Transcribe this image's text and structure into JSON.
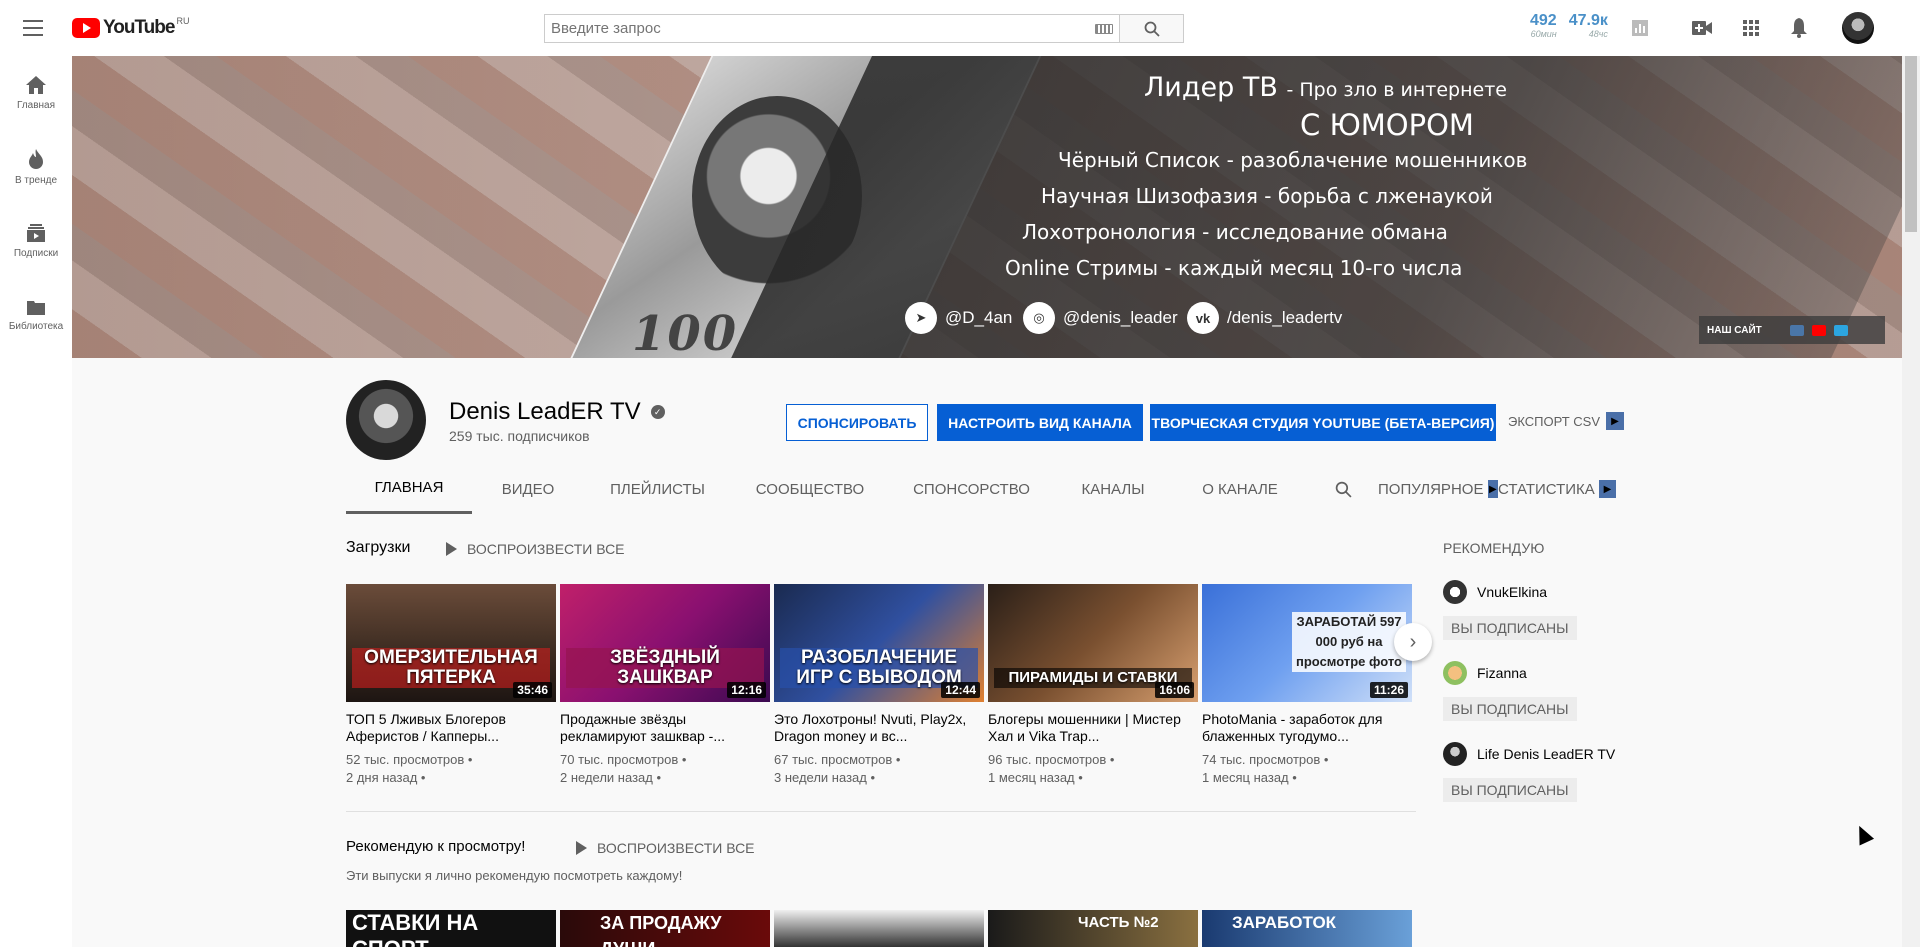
{
  "header": {
    "logo_text": "YouTube",
    "region": "RU",
    "search_placeholder": "Введите запрос",
    "stats": [
      {
        "value": "492",
        "label": "60мин"
      },
      {
        "value": "47.9к",
        "label": "48чс"
      }
    ]
  },
  "sidebar": {
    "items": [
      {
        "label": "Главная",
        "icon": "home-icon"
      },
      {
        "label": "В тренде",
        "icon": "flame-icon"
      },
      {
        "label": "Подписки",
        "icon": "subscriptions-icon"
      },
      {
        "label": "Библиотека",
        "icon": "library-icon"
      }
    ]
  },
  "banner": {
    "title": "Лидер ТВ",
    "title_suffix": "- Про зло в интернете",
    "humor": "С ЮМОРОМ",
    "lines": [
      "Чёрный Список - разоблачение мошенников",
      "Научная Шизофазия - борьба с лженаукой",
      "Лохотронология - исследование обмана",
      "Online Стримы - каждый месяц 10-го числа"
    ],
    "socials": [
      {
        "icon": "telegram-icon",
        "handle": "@D_4an"
      },
      {
        "icon": "instagram-icon",
        "handle": "@denis_leader"
      },
      {
        "icon": "vk-icon",
        "handle": "/denis_leadertv"
      }
    ],
    "bill_number": "100",
    "site_link": "НАШ САЙТ"
  },
  "channel": {
    "name": "Denis LeadER TV",
    "subscribers": "259 тыс. подписчиков",
    "sponsor_btn": "Спонсировать",
    "customize_btn": "Настроить вид канала",
    "studio_btn": "Творческая студия YouTube (бета-версия)",
    "export": "ЭКСПОРТ CSV",
    "tabs": [
      "Главная",
      "Видео",
      "Плейлисты",
      "Сообщество",
      "Спонсорство",
      "Каналы",
      "О канале",
      "Популярное",
      "Статистика"
    ]
  },
  "uploads": {
    "title": "Загрузки",
    "play_all": "Воспроизвести все",
    "videos": [
      {
        "thumb_text": "ОМЕРЗИТЕЛЬНАЯ ПЯТЕРКА",
        "duration": "35:46",
        "title": "ТОП 5 Лживых Блогеров Аферистов / Капперы...",
        "views": "52 тыс. просмотров •",
        "age": "2 дня назад •"
      },
      {
        "thumb_text": "ЗВЁЗДНЫЙ ЗАШКВАР",
        "duration": "12:16",
        "title": "Продажные звёзды рекламируют зашквар -...",
        "views": "70 тыс. просмотров •",
        "age": "2 недели назад •"
      },
      {
        "thumb_text": "РАЗОБЛАЧЕНИЕ ИГР С ВЫВОДОМ",
        "duration": "12:44",
        "title": "Это Лохотроны! Nvuti, Play2x, Dragon money и вс...",
        "views": "67 тыс. просмотров •",
        "age": "3 недели назад •"
      },
      {
        "thumb_text": "ПИРАМИДЫ И СТАВКИ",
        "duration": "16:06",
        "title": "Блогеры мошенники | Мистер Хал и Vika Trap...",
        "views": "96 тыс. просмотров •",
        "age": "1 месяц назад •"
      },
      {
        "thumb_text": "ЗАРАБОТАЙ 597 000 руб на просмотре фото",
        "duration": "11:26",
        "title": "PhotoMania - заработок для блаженных тугодумо...",
        "views": "74 тыс. просмотров •",
        "age": "1 месяц назад •"
      }
    ]
  },
  "recommended": {
    "title": "Рекомендую к просмотру!",
    "play_all": "Воспроизвести все",
    "desc": "Эти выпуски я лично рекомендую посмотреть каждому!",
    "thumbs": [
      "СТАВКИ НА СПОРТ",
      "ЗА ПРОДАЖУ ДУШИ",
      "",
      "ЧАСТЬ №2",
      "ЗАРАБОТОК"
    ]
  },
  "sidebar_right": {
    "title": "Рекомендую",
    "channels": [
      {
        "name": "VnukElkina",
        "button": "Вы подписаны"
      },
      {
        "name": "Fizanna",
        "button": "Вы подписаны"
      },
      {
        "name": "Life Denis LeadER TV",
        "button": "Вы подписаны"
      }
    ]
  }
}
